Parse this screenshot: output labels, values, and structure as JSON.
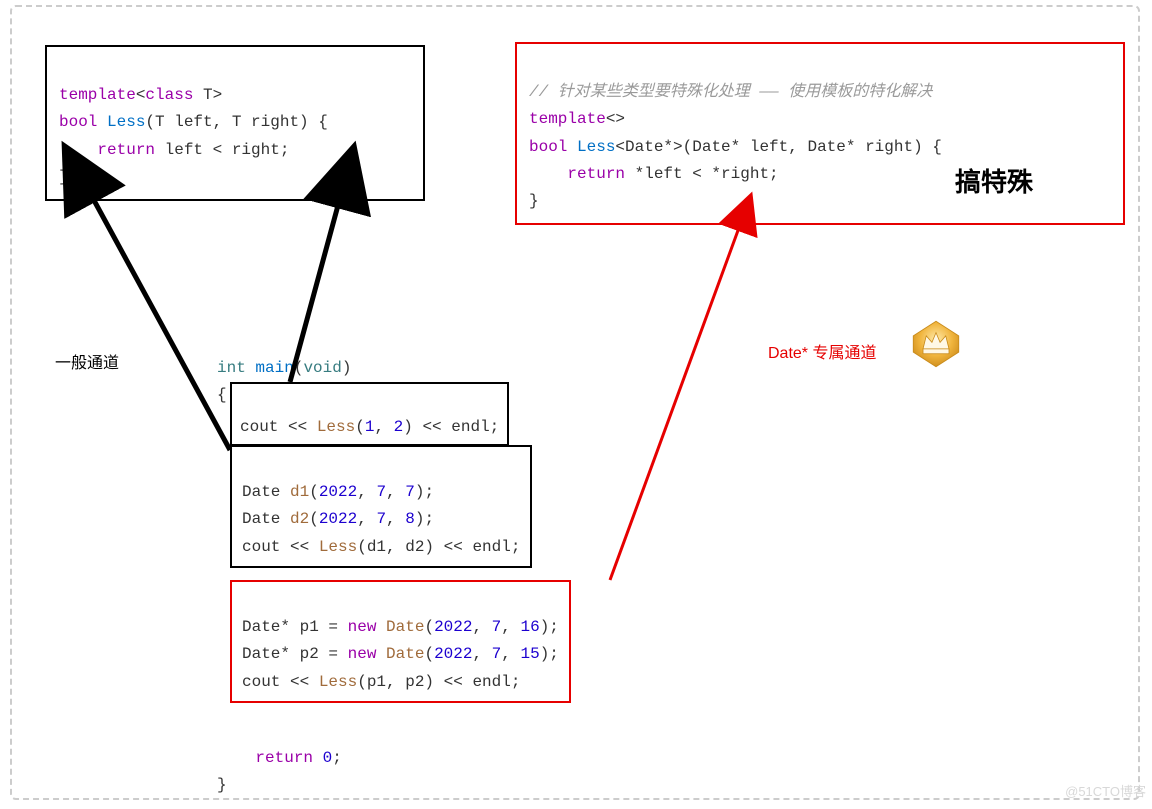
{
  "generic_template": {
    "line1_kw": "template",
    "line1_rest": "<",
    "line1_class": "class",
    "line1_rest2": " T>",
    "line2_bool": "bool",
    "line2_less": " Less",
    "line2_params": "(T left, T right) {",
    "line3_kw": "return",
    "line3_rest": " left < right;",
    "line4": "}"
  },
  "specialized_template": {
    "comment": "// 针对某些类型要特殊化处理 —— 使用模板的特化解决",
    "line2_kw": "template",
    "line2_rest": "<>",
    "line3_bool": "bool",
    "line3_less": " Less",
    "line3_tpl": "<Date*>",
    "line3_params": "(Date* left, Date* right) {",
    "line4_kw": "return",
    "line4_rest": " *left < *right;",
    "line5": "}",
    "big_label": "搞特殊"
  },
  "main_header": {
    "line1_int": "int",
    "line1_main": " main",
    "line1_void_paren_open": "(",
    "line1_void": "void",
    "line1_void_paren_close": ")",
    "line2": "{"
  },
  "call1": {
    "cout": "cout << ",
    "less": "Less",
    "args_open": "(",
    "a1": "1",
    "comma": ", ",
    "a2": "2",
    "args_close": ") << endl;"
  },
  "call2": {
    "l1_pre": "Date ",
    "l1_name": "d1",
    "l1_args_open": "(",
    "l1_a1": "2022",
    "l1_c1": ", ",
    "l1_a2": "7",
    "l1_c2": ", ",
    "l1_a3": "7",
    "l1_close": ");",
    "l2_pre": "Date ",
    "l2_name": "d2",
    "l2_args_open": "(",
    "l2_a1": "2022",
    "l2_c1": ", ",
    "l2_a2": "7",
    "l2_c2": ", ",
    "l2_a3": "8",
    "l2_close": ");",
    "l3_cout": "cout << ",
    "l3_less": "Less",
    "l3_args": "(d1, d2) << endl;"
  },
  "call3": {
    "l1_pre": "Date* p1 = ",
    "l1_new": "new",
    "l1_date": " Date",
    "l1_open": "(",
    "l1_a1": "2022",
    "l1_c1": ", ",
    "l1_a2": "7",
    "l1_c2": ", ",
    "l1_a3": "16",
    "l1_close": ");",
    "l2_pre": "Date* p2 = ",
    "l2_new": "new",
    "l2_date": " Date",
    "l2_open": "(",
    "l2_a1": "2022",
    "l2_c1": ", ",
    "l2_a2": "7",
    "l2_c2": ", ",
    "l2_a3": "15",
    "l2_close": ");",
    "l3_cout": "cout << ",
    "l3_less": "Less",
    "l3_args": "(p1, p2) << endl;"
  },
  "main_footer": {
    "ret_kw": "return",
    "ret_rest": " ",
    "ret_zero": "0",
    "ret_semi": ";",
    "close": "}"
  },
  "labels": {
    "general_channel": "一般通道",
    "date_channel": "Date* 专属通道"
  },
  "watermark": "@51CTO博客"
}
